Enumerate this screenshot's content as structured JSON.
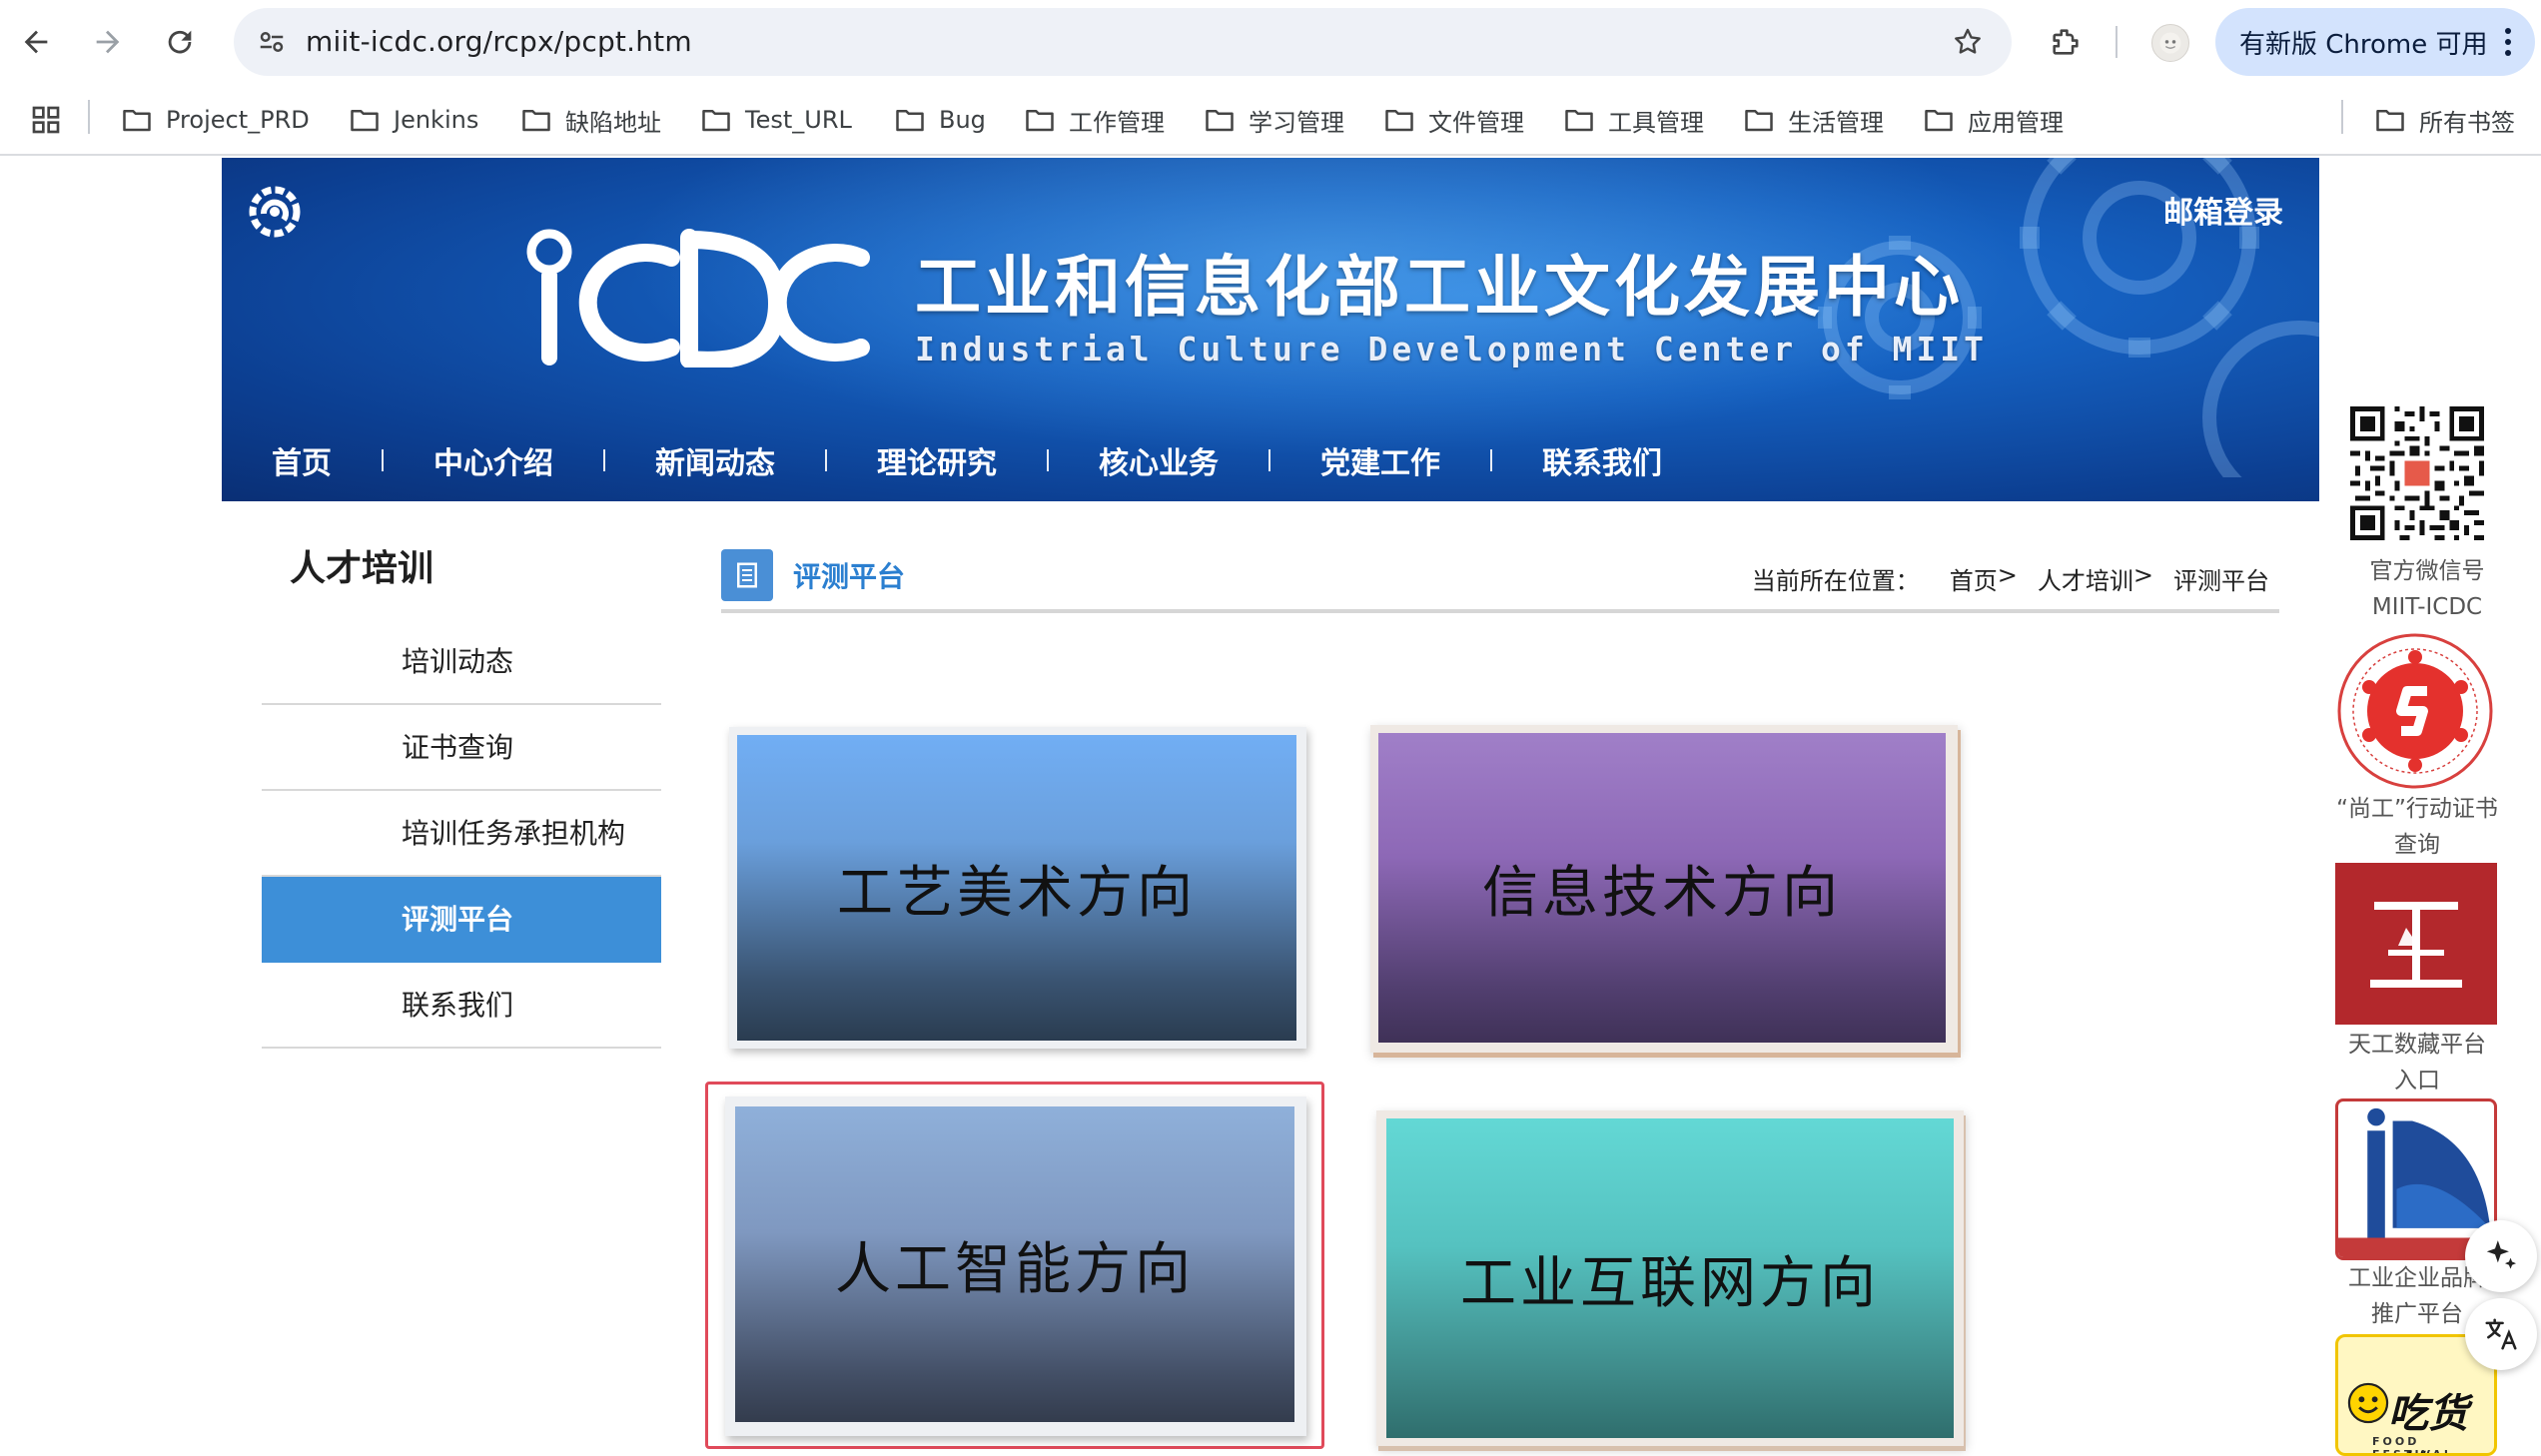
{
  "browser": {
    "url": "miit-icdc.org/rcpx/pcpt.htm",
    "update_label": "有新版 Chrome 可用",
    "icons": [
      "back-icon",
      "forward-icon",
      "reload-icon",
      "site-info-icon",
      "star-icon",
      "extensions-icon",
      "profile-icon",
      "more-icon"
    ]
  },
  "bookmarks": {
    "items": [
      {
        "label": "Project_PRD"
      },
      {
        "label": "Jenkins"
      },
      {
        "label": "缺陷地址"
      },
      {
        "label": "Test_URL"
      },
      {
        "label": "Bug"
      },
      {
        "label": "工作管理"
      },
      {
        "label": "学习管理"
      },
      {
        "label": "文件管理"
      },
      {
        "label": "工具管理"
      },
      {
        "label": "生活管理"
      },
      {
        "label": "应用管理"
      }
    ],
    "all_bookmarks": "所有书签"
  },
  "header": {
    "mail_login": "邮箱登录",
    "org_name_cn": "工业和信息化部工业文化发展中心",
    "org_name_en": "Industrial Culture Development Center of MIIT",
    "nav": [
      "首页",
      "中心介绍",
      "新闻动态",
      "理论研究",
      "核心业务",
      "党建工作",
      "联系我们"
    ]
  },
  "sidebar": {
    "title": "人才培训",
    "items": [
      {
        "label": "培训动态",
        "active": false
      },
      {
        "label": "证书查询",
        "active": false
      },
      {
        "label": "培训任务承担机构",
        "active": false
      },
      {
        "label": "评测平台",
        "active": true
      },
      {
        "label": "联系我们",
        "active": false
      }
    ]
  },
  "content": {
    "title": "评测平台",
    "breadcrumb": {
      "prefix": "当前所在位置：",
      "items": [
        "首页",
        "人才培训",
        "评测平台"
      ],
      "separator": ">"
    },
    "cards": [
      {
        "label": "工艺美术方向"
      },
      {
        "label": "信息技术方向"
      },
      {
        "label": "人工智能方向"
      },
      {
        "label": "工业互联网方向"
      }
    ]
  },
  "floats": {
    "wechat_label": "官方微信号",
    "wechat_id": "MIIT-ICDC",
    "shanggong_label_1": "“尚工”行动证书",
    "shanggong_label_2": "查询",
    "tiangong_label_1": "天工数藏平台",
    "tiangong_label_2": "入口",
    "brand_label_1": "工业企业品牌",
    "brand_label_2": "推广平台",
    "food_text": "吃货节",
    "food_sub": "FOOD FESTIVAL"
  },
  "colors": {
    "accent_blue": "#3d8fd8",
    "link_blue": "#2b7fd0",
    "banner_blue": "#1560c0",
    "highlight_red": "#e04a5a"
  }
}
